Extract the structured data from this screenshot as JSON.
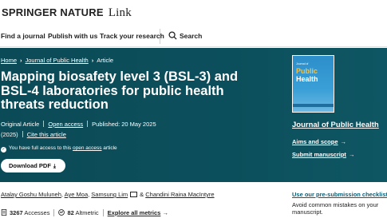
{
  "header": {
    "brand": "Springer Nature",
    "product": "Link"
  },
  "nav": {
    "find_journal": "Find a journal",
    "publish": "Publish with us",
    "track": "Track your research",
    "search": "Search"
  },
  "breadcrumb": {
    "home": "Home",
    "journal": "Journal of Public Health",
    "current": "Article"
  },
  "article": {
    "title": "Mapping biosafety level 3 (BSL-3) and BSL-4 laboratories for public health threats reduction",
    "type": "Original Article",
    "access": "Open access",
    "published": "Published: 20 May 2025",
    "year": "(2025)",
    "cite": "Cite this article",
    "access_note_prefix": "You have full access to this",
    "access_note_link": "open access",
    "access_note_suffix": "article",
    "download_label": "Download PDF"
  },
  "sidebar": {
    "cover_small": "Journal of",
    "cover_big1": "Public",
    "cover_big2": "Health",
    "journal_name": "Journal of Public Health",
    "aims": "Aims and scope",
    "submit": "Submit manuscript",
    "pre_submission": "Use our pre-submission checklist",
    "avoid": "Avoid common mistakes on your manuscript."
  },
  "authors": {
    "a1": "Atalay Goshu Muluneh",
    "a2": "Aye Moa",
    "a3": "Samsung Lim",
    "amp": "& ",
    "a4": "Chandini Raina MacIntyre"
  },
  "metrics": {
    "accesses_num": "3267",
    "accesses_label": "Accesses",
    "altmetric_num": "82",
    "altmetric_label": "Altmetric",
    "explore": "Explore all metrics"
  },
  "colors": {
    "hero_bg": "#0c4f5c",
    "link_blue": "#0c5f77"
  }
}
